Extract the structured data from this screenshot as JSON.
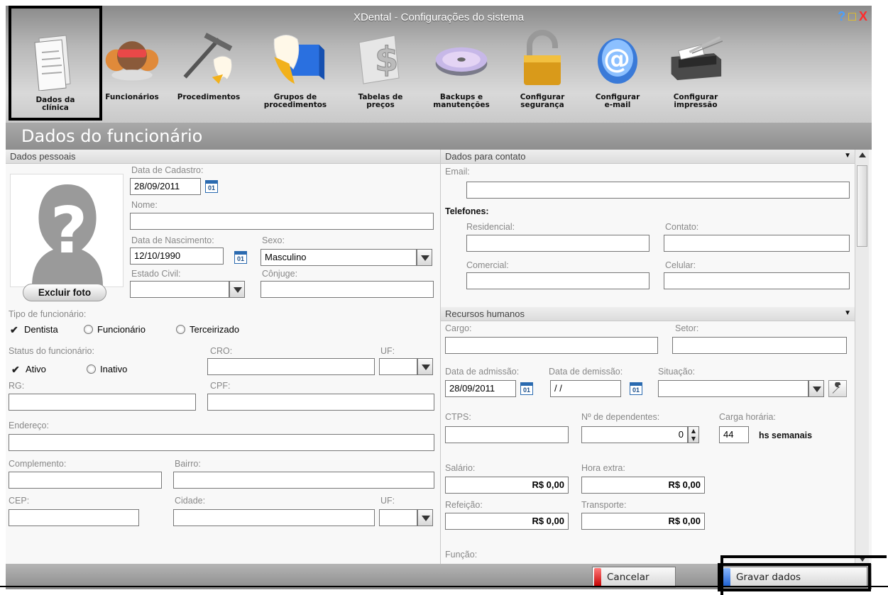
{
  "window": {
    "title": "XDental - Configurações do sistema",
    "help": "?",
    "maximize": "□",
    "close": "X"
  },
  "toolbar": {
    "items": [
      {
        "label": "Dados da\nclínica",
        "icon": "document-icon"
      },
      {
        "label": "Funcionários",
        "icon": "staff-icon"
      },
      {
        "label": "Procedimentos",
        "icon": "tooth-tools-icon"
      },
      {
        "label": "Grupos de\nprocedimentos",
        "icon": "tooth-group-icon"
      },
      {
        "label": "Tabelas de\npreços",
        "icon": "price-table-icon"
      },
      {
        "label": "Backups e\nmanutenções",
        "icon": "disc-icon"
      },
      {
        "label": "Configurar\nsegurança",
        "icon": "padlock-icon"
      },
      {
        "label": "Configurar\ne-mail",
        "icon": "at-sign-icon"
      },
      {
        "label": "Configurar\nimpressão",
        "icon": "printer-icon"
      }
    ]
  },
  "section_title": "Dados do funcionário",
  "personal": {
    "header": "Dados pessoais",
    "delete_photo": "Excluir foto",
    "data_cadastro_label": "Data de Cadastro:",
    "data_cadastro": "28/09/2011",
    "calendar_text": "01",
    "nome_label": "Nome:",
    "nome": "",
    "nascimento_label": "Data de Nascimento:",
    "nascimento": "12/10/1990",
    "sexo_label": "Sexo:",
    "sexo": "Masculino",
    "estado_civil_label": "Estado Civil:",
    "estado_civil": "",
    "conjuge_label": "Cônjuge:",
    "conjuge": "",
    "tipo_label": "Tipo de funcionário:",
    "tipo_options": [
      "Dentista",
      "Funcionário",
      "Terceirizado"
    ],
    "tipo_selected": "Dentista",
    "status_label": "Status do funcionário:",
    "status_options": [
      "Ativo",
      "Inativo"
    ],
    "status_selected": "Ativo",
    "cro_label": "CRO:",
    "cro": "",
    "uf_label": "UF:",
    "rg_label": "RG:",
    "cpf_label": "CPF:",
    "endereco_label": "Endereço:",
    "complemento_label": "Complemento:",
    "bairro_label": "Bairro:",
    "cep_label": "CEP:",
    "cidade_label": "Cidade:"
  },
  "contact": {
    "header": "Dados para contato",
    "email_label": "Email:",
    "telefones_label": "Telefones:",
    "residencial_label": "Residencial:",
    "contato_label": "Contato:",
    "comercial_label": "Comercial:",
    "celular_label": "Celular:"
  },
  "hr": {
    "header": "Recursos humanos",
    "cargo_label": "Cargo:",
    "setor_label": "Setor:",
    "admissao_label": "Data de admissão:",
    "admissao": "28/09/2011",
    "demissao_label": "Data de demissão:",
    "demissao": " / /",
    "situacao_label": "Situação:",
    "ctps_label": "CTPS:",
    "dependentes_label": "Nº de dependentes:",
    "dependentes": "0",
    "carga_label": "Carga horária:",
    "carga": "44",
    "carga_unit": "hs semanais",
    "salario_label": "Salário:",
    "salario": "R$ 0,00",
    "hora_extra_label": "Hora extra:",
    "hora_extra": "R$ 0,00",
    "refeicao_label": "Refeição:",
    "refeicao": "R$ 0,00",
    "transporte_label": "Transporte:",
    "transporte": "R$ 0,00",
    "funcao_label": "Função:"
  },
  "actions": {
    "cancel": "Cancelar",
    "save": "Gravar dados"
  }
}
